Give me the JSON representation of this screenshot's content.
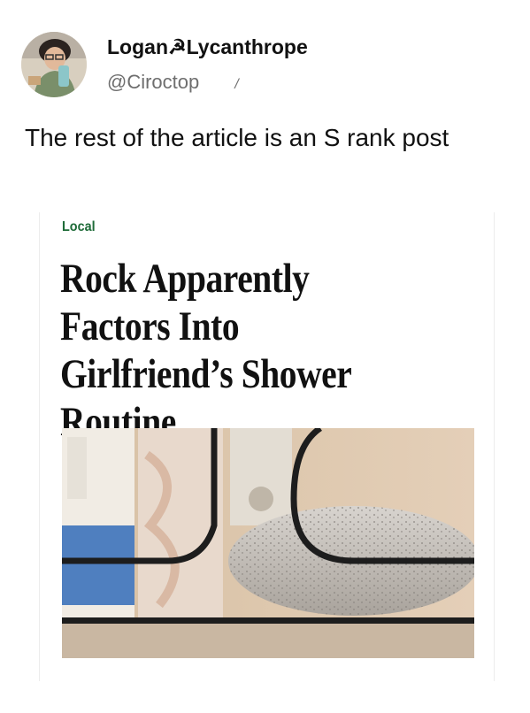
{
  "tweet": {
    "display_name": "Logan☭Lycanthrope",
    "handle": "@Ciroctop",
    "handle_suffix": "/",
    "text": "The rest of the article is an S rank post",
    "avatar_icon": "profile-photo"
  },
  "article": {
    "section": "Local",
    "headline": "Rock Apparently Factors Into Girlfriend’s Shower Routine",
    "image_subject": "pumice stone in shower caddy",
    "section_color": "#1e6b38"
  }
}
